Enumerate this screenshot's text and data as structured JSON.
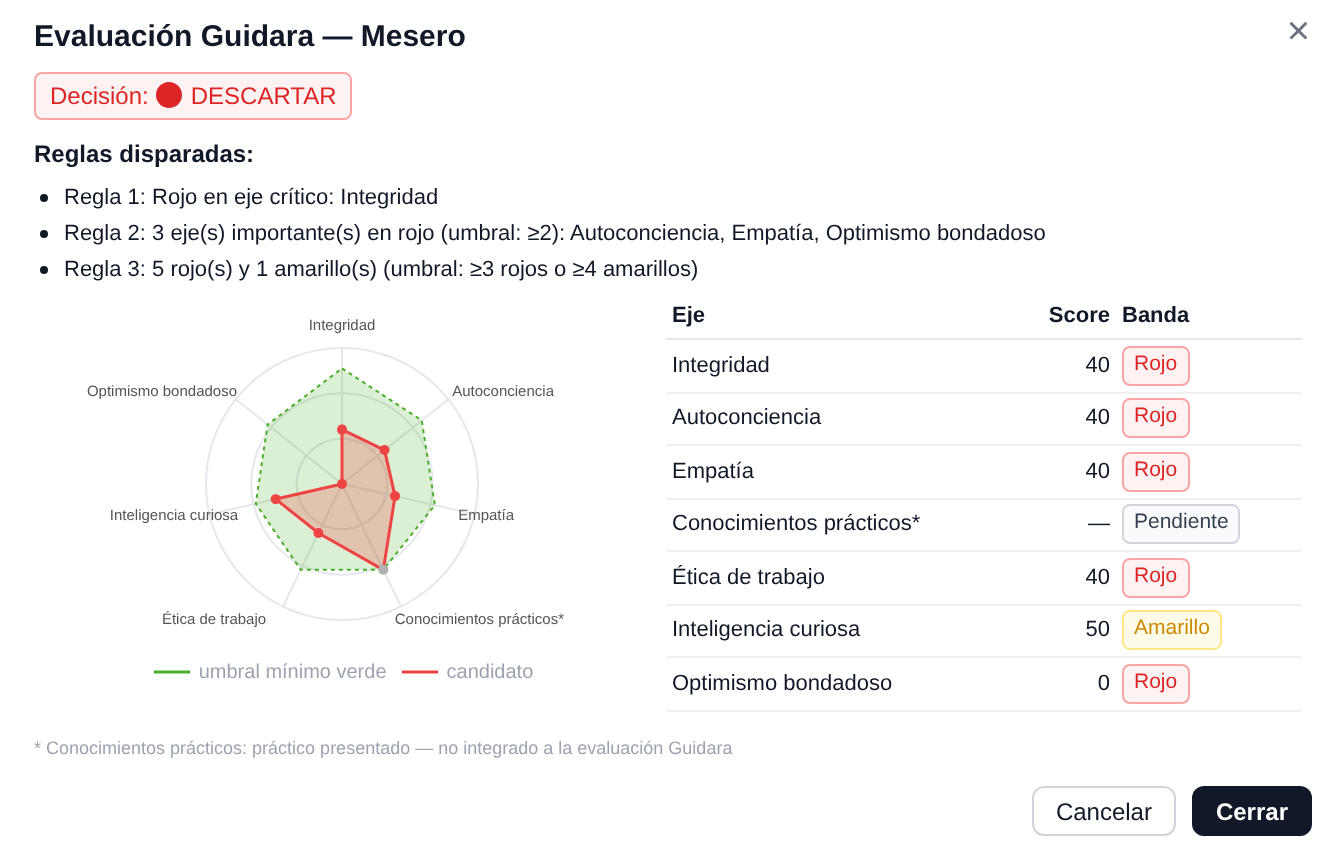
{
  "dialog": {
    "title": "Evaluación Guidara — Mesero",
    "close_icon": "×"
  },
  "decision": {
    "label": "Decisión:",
    "value": "DESCARTAR",
    "color": "#dc2626"
  },
  "rules": {
    "heading": "Reglas disparadas:",
    "items": [
      "Regla 1: Rojo en eje crítico: Integridad",
      "Regla 2: 3 eje(s) importante(s) en rojo (umbral: ≥2): Autoconciencia, Empatía, Optimismo bondadoso",
      "Regla 3: 5 rojo(s) y 1 amarillo(s) (umbral: ≥3 rojos o ≥4 amarillos)"
    ]
  },
  "chart": {
    "axis_labels": [
      "Integridad",
      "Optimismo bondadoso",
      "Autoconciencia",
      "Inteligencia curiosa",
      "Empatía",
      "Ética de trabajo",
      "Conocimientos prácticos*"
    ],
    "legend": [
      {
        "name": "umbral mínimo verde",
        "color": "#4caf2a"
      },
      {
        "name": "candidato",
        "color": "#ef4444"
      }
    ]
  },
  "table": {
    "columns": [
      "Eje",
      "Score",
      "Banda"
    ],
    "rows": [
      {
        "axis": "Integridad",
        "score": "40",
        "band": "Rojo",
        "kind": "red"
      },
      {
        "axis": "Autoconciencia",
        "score": "40",
        "band": "Rojo",
        "kind": "red"
      },
      {
        "axis": "Empatía",
        "score": "40",
        "band": "Rojo",
        "kind": "red"
      },
      {
        "axis": "Conocimientos prácticos*",
        "score": "—",
        "band": "Pendiente",
        "kind": "pending"
      },
      {
        "axis": "Ética de trabajo",
        "score": "40",
        "band": "Rojo",
        "kind": "red"
      },
      {
        "axis": "Inteligencia curiosa",
        "score": "50",
        "band": "Amarillo",
        "kind": "yellow"
      },
      {
        "axis": "Optimismo bondadoso",
        "score": "0",
        "band": "Rojo",
        "kind": "red"
      }
    ]
  },
  "footnote": "* Conocimientos prácticos: práctico presentado — no integrado a la evaluación Guidara",
  "buttons": [
    {
      "label": "Cancelar",
      "kind": "secondary"
    },
    {
      "label": "Cerrar",
      "kind": "primary"
    }
  ]
}
